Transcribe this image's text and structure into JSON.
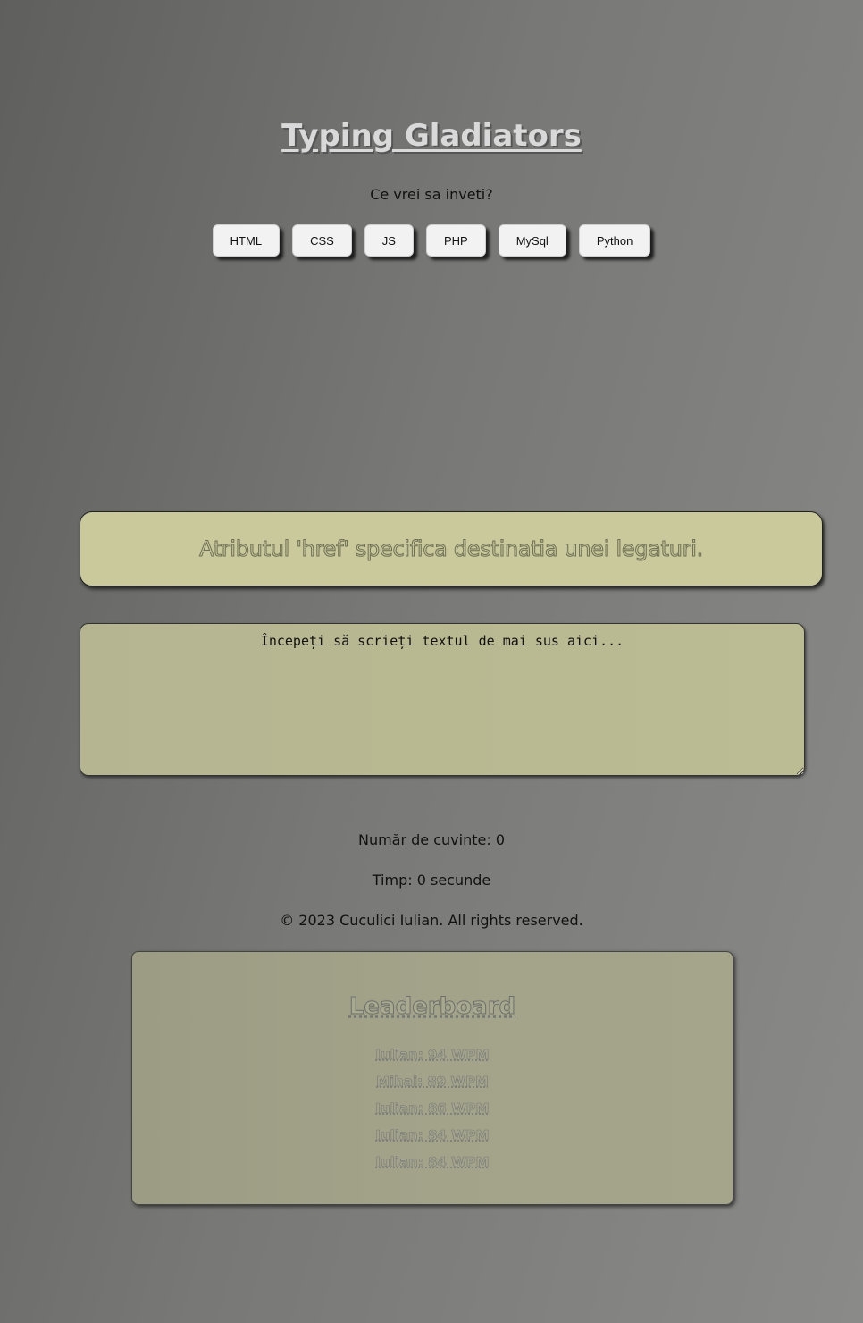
{
  "header": {
    "title": "Typing Gladiators",
    "subtitle": "Ce vrei sa inveti?"
  },
  "languages": [
    "HTML",
    "CSS",
    "JS",
    "PHP",
    "MySql",
    "Python"
  ],
  "quote": {
    "text": "Atributul 'href' specifica destinatia unei legaturi."
  },
  "typing": {
    "placeholder": "Începeți să scrieți textul de mai sus aici..."
  },
  "stats": {
    "word_count": "Număr de cuvinte: 0",
    "time": "Timp: 0 secunde"
  },
  "footer": {
    "copyright": "© 2023 Cuculici Iulian. All rights reserved."
  },
  "leaderboard": {
    "title": "Leaderboard",
    "entries": [
      "Iulian: 94 WPM",
      "Mihai: 89 WPM",
      "Iulian: 86 WPM",
      "Iulian: 84 WPM",
      "Iulian: 84 WPM"
    ]
  }
}
